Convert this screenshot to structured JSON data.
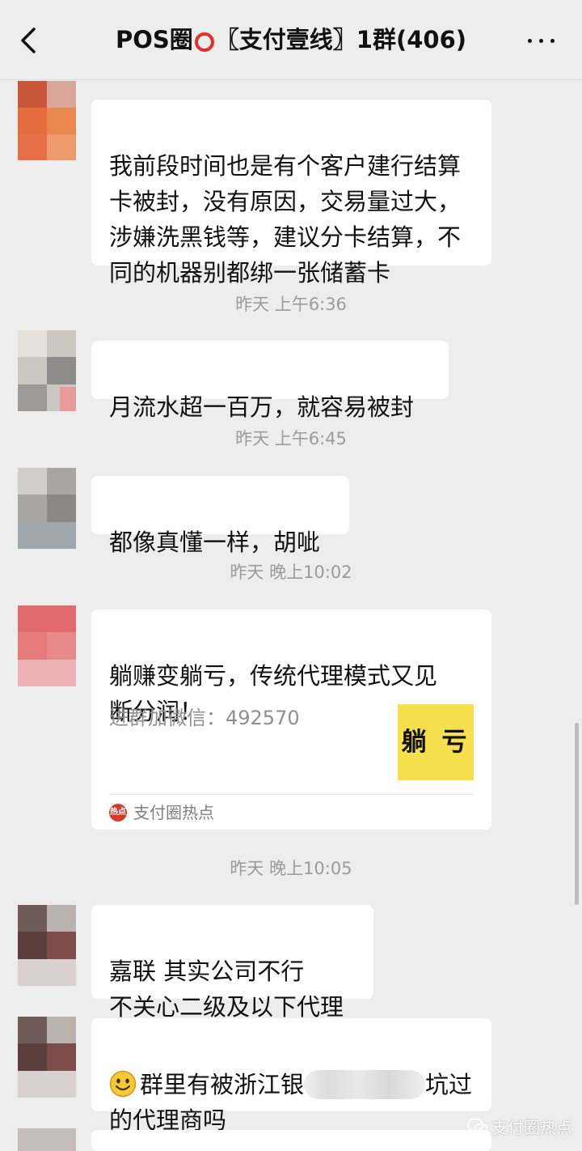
{
  "header": {
    "title_prefix": "POS圈",
    "title_suffix": "〖支付壹线〗1群(406)"
  },
  "messages": [
    {
      "text": "我前段时间也是有个客户建行结算\n卡被封，没有原因，交易量过大，\n涉嫌洗黑钱等，建议分卡结算，不\n同的机器别都绑一张储蓄卡"
    },
    {
      "text": "月流水超一百万，就容易被封"
    },
    {
      "text": "都像真懂一样，胡呲"
    },
    {
      "card_title": "躺赚变躺亏，传统代理模式又见\n断分润！",
      "card_desc": "进群加微信：492570",
      "card_thumb_text": "躺 亏",
      "card_source": "支付圈热点",
      "card_source_logo": "热点"
    },
    {
      "text": "嘉联 其实公司不行\n不关心二级及以下代理"
    },
    {
      "text_before": "群里有被浙江银",
      "text_after": "坑过\n的代理商吗"
    }
  ],
  "times": [
    "昨天 上午6:36",
    "昨天 上午6:45",
    "昨天 晚上10:02",
    "昨天 晚上10:05"
  ],
  "watermark": "支付圈热点",
  "icons": {
    "back": "chevron-left-icon",
    "more": "more-dots-icon",
    "emoji": "smile-emoji-icon",
    "watermark": "wechat-icon"
  },
  "colors": {
    "background": "#ededed",
    "bubble": "#ffffff",
    "title_ring": "#e0322b",
    "thumb": "#f6e04d"
  }
}
